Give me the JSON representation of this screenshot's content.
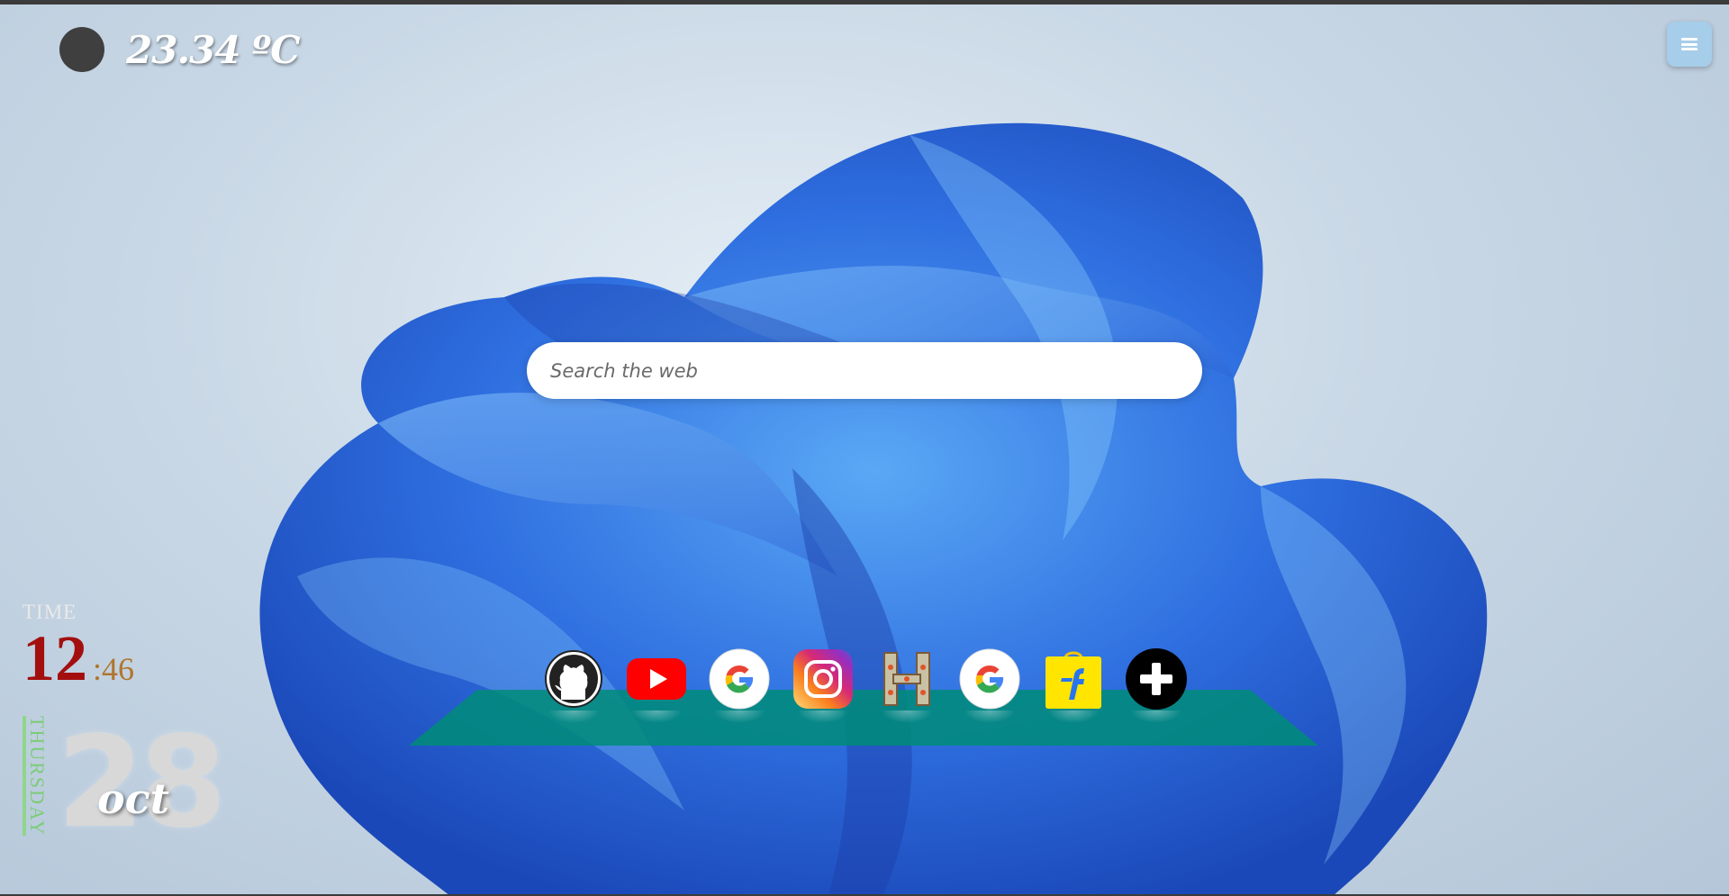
{
  "weather": {
    "temperature": "23.34 ºC",
    "icon": "weather-icon"
  },
  "menu": {
    "icon": "hamburger-menu-icon"
  },
  "search": {
    "placeholder": "Search the web",
    "value": ""
  },
  "shortcuts": [
    {
      "name": "github",
      "icon": "github-icon"
    },
    {
      "name": "youtube",
      "icon": "youtube-icon"
    },
    {
      "name": "google",
      "icon": "google-icon"
    },
    {
      "name": "instagram",
      "icon": "instagram-icon"
    },
    {
      "name": "h-site",
      "icon": "h-letter-icon"
    },
    {
      "name": "google",
      "icon": "google-icon"
    },
    {
      "name": "flipkart",
      "icon": "flipkart-icon"
    },
    {
      "name": "add-shortcut",
      "icon": "plus-icon"
    }
  ],
  "clock": {
    "label": "TIME",
    "hour": "12",
    "minute": ":46",
    "weekday": "THURSDAY",
    "day": "28",
    "month": "oct"
  },
  "colors": {
    "menu_button": "#a6cde9",
    "dock_shelf": "#008c78",
    "hour": "#a30f0f",
    "minute": "#b0762e",
    "weekday": "#7ccc78"
  }
}
